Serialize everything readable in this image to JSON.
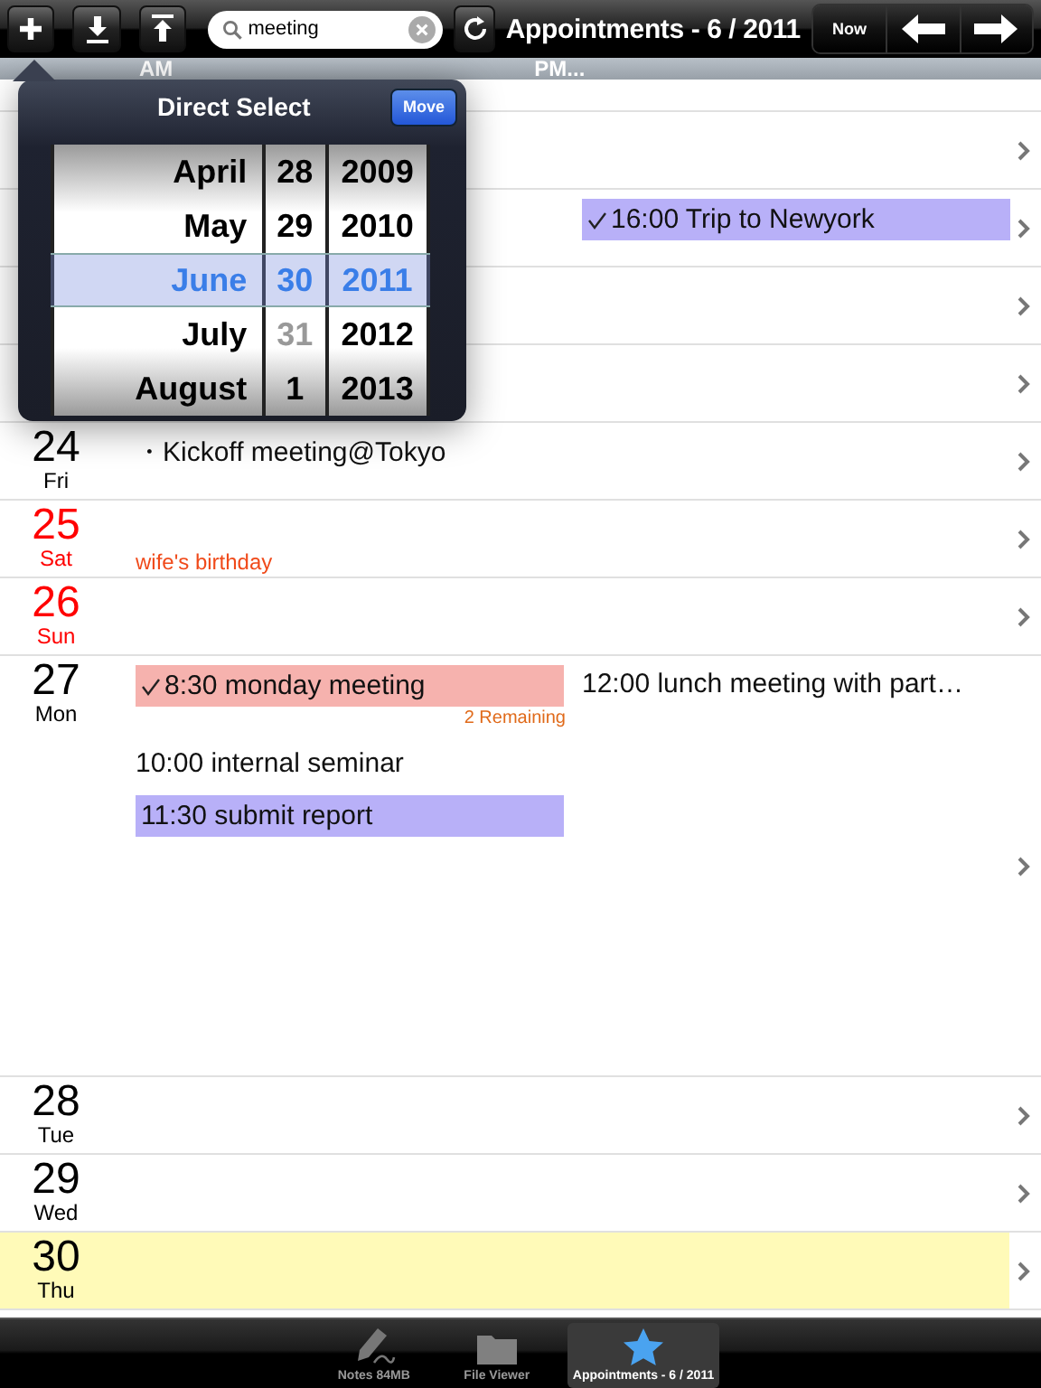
{
  "toolbar": {
    "search": {
      "value": "meeting"
    },
    "title": "Appointments - 6 / 2011",
    "now_label": "Now"
  },
  "header": {
    "am": "AM",
    "pm": "PM..."
  },
  "rows": [
    {
      "highlighted": false,
      "am": [],
      "pm": []
    },
    {
      "highlighted": false,
      "am": [],
      "pm": [
        {
          "kind": "block",
          "text": "16:00 Trip to Newyork",
          "color": "#b8b0f8",
          "checked": true
        }
      ]
    },
    {
      "highlighted": false,
      "am": [],
      "pm": []
    },
    {
      "highlighted": false,
      "am": [],
      "pm": []
    },
    {
      "day": "24",
      "weekday": "Fri",
      "weekend": false,
      "highlighted": false,
      "am": [
        {
          "kind": "text",
          "text": "・Kickoff meeting@Tokyo"
        }
      ],
      "pm": []
    },
    {
      "day": "25",
      "weekday": "Sat",
      "weekend": true,
      "highlighted": false,
      "am": [
        {
          "kind": "note",
          "text": "wife's birthday"
        }
      ],
      "pm": []
    },
    {
      "day": "26",
      "weekday": "Sun",
      "weekend": true,
      "highlighted": false,
      "am": [],
      "pm": []
    },
    {
      "day": "27",
      "weekday": "Mon",
      "weekend": false,
      "highlighted": false,
      "am": [
        {
          "kind": "block",
          "text": "8:30 monday meeting",
          "color": "#f6b2ae",
          "checked": true,
          "remaining": "2 Remaining"
        },
        {
          "kind": "text",
          "text": "10:00 internal seminar"
        },
        {
          "kind": "block",
          "text": "11:30 submit report",
          "color": "#b8b0f8",
          "checked": false
        }
      ],
      "pm": [
        {
          "kind": "text",
          "text": "12:00 lunch meeting with part…"
        }
      ]
    },
    {
      "day": "28",
      "weekday": "Tue",
      "weekend": false,
      "highlighted": false,
      "am": [],
      "pm": []
    },
    {
      "day": "29",
      "weekday": "Wed",
      "weekend": false,
      "highlighted": false,
      "am": [],
      "pm": []
    },
    {
      "day": "30",
      "weekday": "Thu",
      "weekend": false,
      "highlighted": true,
      "am": [],
      "pm": []
    }
  ],
  "popover": {
    "title": "Direct Select",
    "button": "Move",
    "columns": [
      {
        "kind": "month",
        "items": [
          {
            "text": "April",
            "disabled": false,
            "selected": false
          },
          {
            "text": "May",
            "disabled": false,
            "selected": false
          },
          {
            "text": "June",
            "disabled": false,
            "selected": true
          },
          {
            "text": "July",
            "disabled": false,
            "selected": false
          },
          {
            "text": "August",
            "disabled": false,
            "selected": false
          }
        ]
      },
      {
        "kind": "day",
        "items": [
          {
            "text": "28",
            "disabled": false,
            "selected": false
          },
          {
            "text": "29",
            "disabled": false,
            "selected": false
          },
          {
            "text": "30",
            "disabled": false,
            "selected": true
          },
          {
            "text": "31",
            "disabled": true,
            "selected": false
          },
          {
            "text": "1",
            "disabled": false,
            "selected": false
          }
        ]
      },
      {
        "kind": "year",
        "items": [
          {
            "text": "2009",
            "disabled": false,
            "selected": false
          },
          {
            "text": "2010",
            "disabled": false,
            "selected": false
          },
          {
            "text": "2011",
            "disabled": false,
            "selected": true
          },
          {
            "text": "2012",
            "disabled": false,
            "selected": false
          },
          {
            "text": "2013",
            "disabled": false,
            "selected": false
          }
        ]
      }
    ]
  },
  "tabbar": [
    {
      "kind": "notes",
      "label": "Notes 84MB",
      "selected": false
    },
    {
      "kind": "files",
      "label": "File Viewer",
      "selected": false
    },
    {
      "kind": "appointments",
      "label": "Appointments - 6 / 2011",
      "selected": true
    }
  ]
}
